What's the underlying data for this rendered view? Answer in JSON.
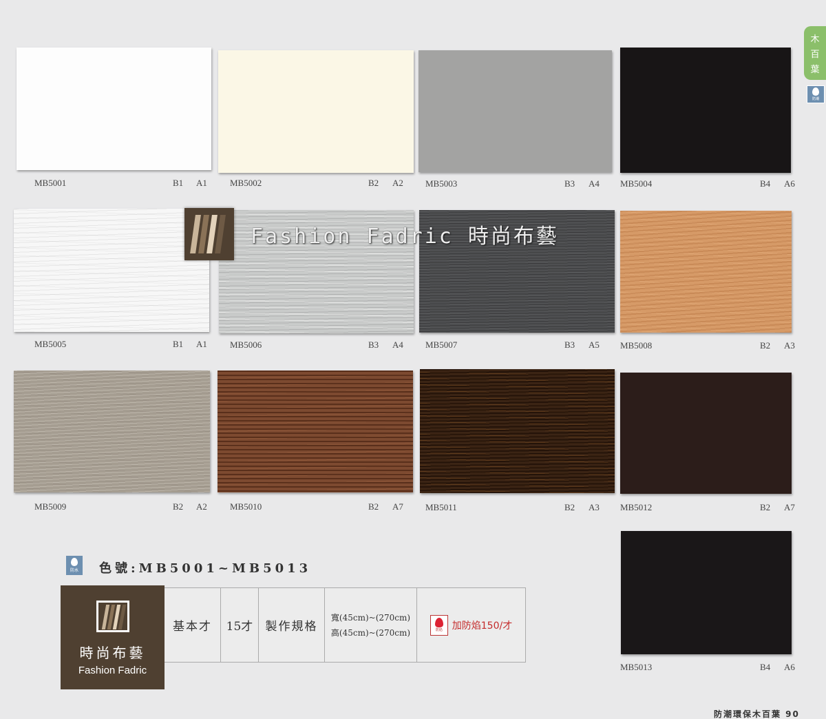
{
  "side_tab": {
    "chars": [
      "木",
      "百",
      "葉"
    ],
    "icon_label": "防潮"
  },
  "swatches": [
    {
      "code": "MB5001",
      "grade": "B1",
      "grade2": "A1",
      "color": "#fdfdfd"
    },
    {
      "code": "MB5002",
      "grade": "B2",
      "grade2": "A2",
      "color": "#fbf7e6"
    },
    {
      "code": "MB5003",
      "grade": "B3",
      "grade2": "A4",
      "color": "#a3a3a2"
    },
    {
      "code": "MB5004",
      "grade": "B4",
      "grade2": "A6",
      "color": "#181516"
    },
    {
      "code": "MB5005",
      "grade": "B1",
      "grade2": "A1",
      "color": "#f7f7f7"
    },
    {
      "code": "MB5006",
      "grade": "B3",
      "grade2": "A4",
      "color": "#c9cbca"
    },
    {
      "code": "MB5007",
      "grade": "B3",
      "grade2": "A5",
      "color": "#4e4f51"
    },
    {
      "code": "MB5008",
      "grade": "B2",
      "grade2": "A3",
      "color": "#d69a67"
    },
    {
      "code": "MB5009",
      "grade": "B2",
      "grade2": "A2",
      "color": "#a59d91"
    },
    {
      "code": "MB5010",
      "grade": "B2",
      "grade2": "A7",
      "color": "#7d4a30"
    },
    {
      "code": "MB5011",
      "grade": "B2",
      "grade2": "A3",
      "color": "#3b2414"
    },
    {
      "code": "MB5012",
      "grade": "B2",
      "grade2": "A7",
      "color": "#2c1d1a"
    },
    {
      "code": "MB5013",
      "grade": "B4",
      "grade2": "A6",
      "color": "#1a1718"
    }
  ],
  "watermark": {
    "text": "Fashion Fadric  時尚布藝"
  },
  "color_number": {
    "icon_label": "防水",
    "text": "色號:MB5001~MB5013"
  },
  "brand": {
    "name_cn": "時尚布藝",
    "name_en": "Fashion Fadric"
  },
  "spec": {
    "basic_label": "基本才",
    "basic_value": "15才",
    "size_label": "製作規格",
    "width": "寬(45cm)~(270cm)",
    "height": "高(45cm)~(270cm)",
    "fire_icon_label": "防焰",
    "fire_text": "加防焰150/才"
  },
  "footer": "防潮環保木百葉 90"
}
